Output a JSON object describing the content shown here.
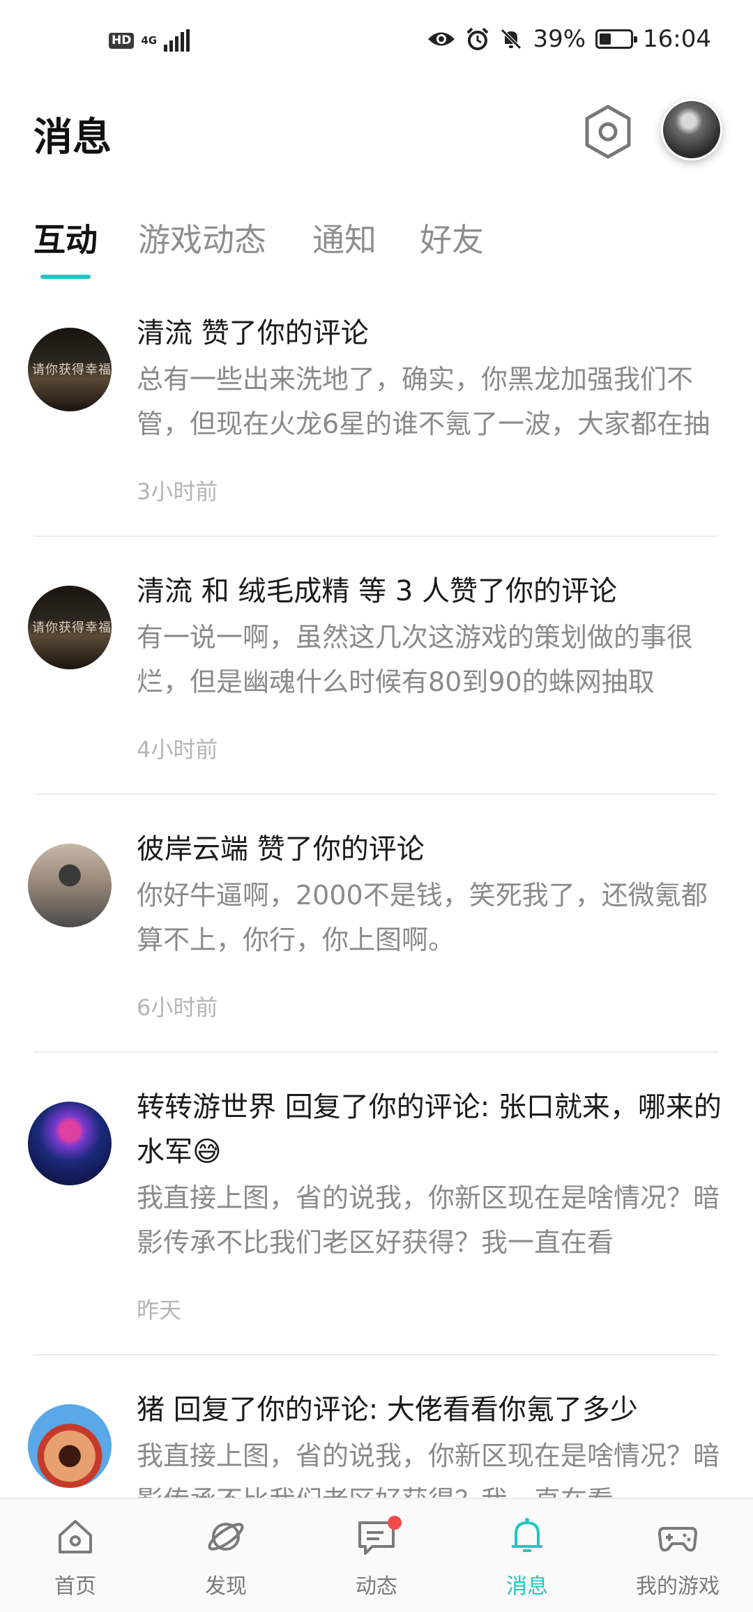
{
  "status_bar": {
    "hd": "HD",
    "network": "4G",
    "battery_text": "39%",
    "battery_level": 0.39,
    "time": "16:04"
  },
  "header": {
    "title": "消息"
  },
  "tabs": [
    {
      "label": "互动",
      "active": true
    },
    {
      "label": "游戏动态",
      "active": false
    },
    {
      "label": "通知",
      "active": false
    },
    {
      "label": "好友",
      "active": false
    }
  ],
  "accent_color": "#1fc7c2",
  "messages": [
    {
      "actor": "清流 赞了你的评论",
      "content": "总有一些出来洗地了，确实，你黑龙加强我们不管，但现在火龙6星的谁不氪了一波，大家都在抽",
      "time": "3小时前",
      "avatar_text": "请你获得幸福!!"
    },
    {
      "actor": "清流 和 绒毛成精 等 3 人赞了你的评论",
      "content": "有一说一啊，虽然这几次这游戏的策划做的事很烂，但是幽魂什么时候有80到90的蛛网抽取",
      "time": "4小时前",
      "avatar_text": "请你获得幸福!!"
    },
    {
      "actor": "彼岸云端 赞了你的评论",
      "content": "你好牛逼啊，2000不是钱，笑死我了，还微氪都算不上，你行，你上图啊。",
      "time": "6小时前"
    },
    {
      "actor": "转转游世界 回复了你的评论: 张口就来，哪来的水军😅",
      "content": "我直接上图，省的说我，你新区现在是啥情况？暗影传承不比我们老区好获得？我一直在看",
      "time": "昨天"
    },
    {
      "actor": "猪 回复了你的评论: 大佬看看你氪了多少",
      "content": "我直接上图，省的说我，你新区现在是啥情况？暗影传承不比我们老区好获得？我一直在看",
      "time": ""
    }
  ],
  "bottom_nav": [
    {
      "label": "首页",
      "icon": "home-icon",
      "active": false
    },
    {
      "label": "发现",
      "icon": "planet-icon",
      "active": false
    },
    {
      "label": "动态",
      "icon": "chat-icon",
      "active": false,
      "badge_dot": true
    },
    {
      "label": "消息",
      "icon": "bell-icon",
      "active": true
    },
    {
      "label": "我的游戏",
      "icon": "gamepad-icon",
      "active": false
    }
  ]
}
